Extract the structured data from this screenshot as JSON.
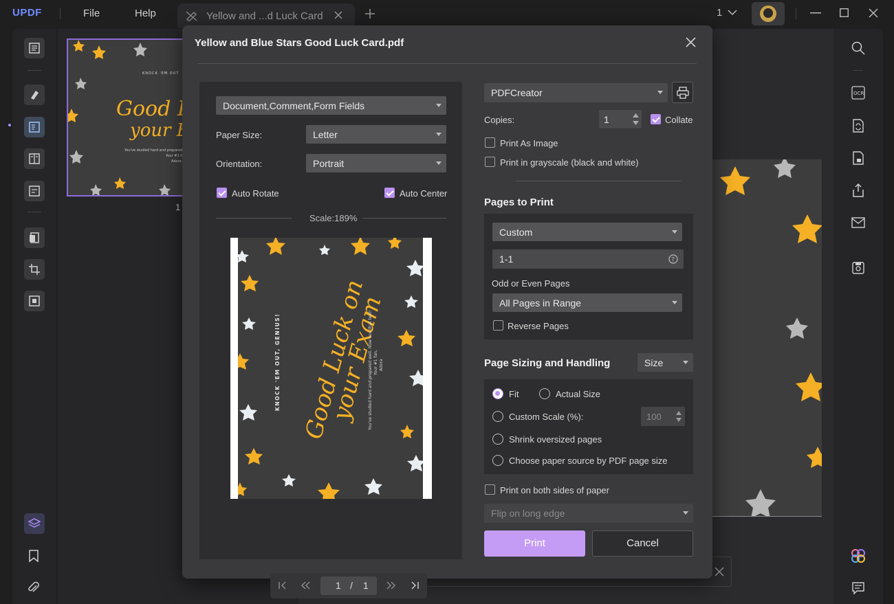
{
  "app": {
    "logo": "UPDF",
    "menu": [
      "File",
      "Help"
    ],
    "tab_title": "Yellow and ...d Luck Card",
    "page_indicator": "1",
    "thumb_page_number": "1"
  },
  "dialog": {
    "title": "Yellow and Blue Stars Good Luck Card.pdf",
    "content_select": "Document,Comment,Form Fields",
    "paper_size_label": "Paper Size:",
    "paper_size_value": "Letter",
    "orientation_label": "Orientation:",
    "orientation_value": "Portrait",
    "auto_rotate_label": "Auto Rotate",
    "auto_center_label": "Auto Center",
    "scale_label": "Scale:189%",
    "pager": {
      "current": "1",
      "sep": "/",
      "total": "1"
    },
    "printer": "PDFCreator",
    "copies_label": "Copies:",
    "copies_value": "1",
    "collate_label": "Collate",
    "print_as_image_label": "Print As Image",
    "grayscale_label": "Print in grayscale (black and white)",
    "pages_to_print_head": "Pages to Print",
    "pages_select": "Custom",
    "range_value": "1-1",
    "odd_even_label": "Odd or Even Pages",
    "odd_even_value": "All Pages in Range",
    "reverse_label": "Reverse Pages",
    "sizing_head": "Page Sizing and Handling",
    "sizing_select": "Size",
    "fit_label": "Fit",
    "actual_size_label": "Actual Size",
    "custom_scale_label": "Custom Scale (%):",
    "custom_scale_value": "100",
    "shrink_label": "Shrink oversized pages",
    "paper_source_label": "Choose paper source by PDF page size",
    "both_sides_label": "Print on both sides of paper",
    "flip_value": "Flip on long edge",
    "print_button": "Print",
    "cancel_button": "Cancel"
  },
  "preview": {
    "headline1": "Good Luck on",
    "headline2": "your Exam",
    "kicker": "KNOCK 'EM OUT, GENIUS!",
    "message": "You've studied hard and prepared well. Now ace that test!",
    "sign1": "Your #1 fan,",
    "sign2": "Adora"
  },
  "colors": {
    "accent": "#b990f0",
    "star_yellow": "#f5b025",
    "star_white": "#e8eef2",
    "card_bg": "#3d3d3d"
  }
}
